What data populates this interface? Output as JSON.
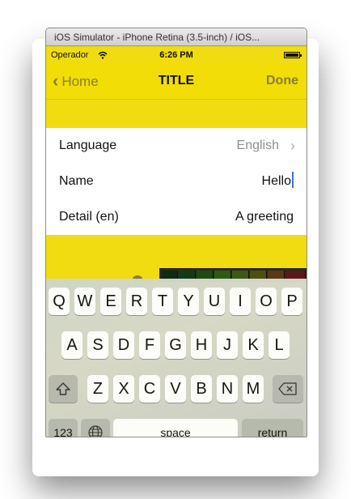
{
  "window": {
    "title": "iOS Simulator - iPhone Retina (3.5-inch) / iOS..."
  },
  "statusbar": {
    "carrier": "Operador",
    "time": "6:26 PM"
  },
  "navbar": {
    "back": "Home",
    "title": "TITLE",
    "done": "Done"
  },
  "table": {
    "rows": [
      {
        "label": "Language",
        "value": "English"
      },
      {
        "label": "Name",
        "value": "Hello"
      },
      {
        "label": "Detail (en)",
        "value": "A greeting"
      }
    ]
  },
  "keyboard": {
    "row1": [
      "Q",
      "W",
      "E",
      "R",
      "T",
      "Y",
      "U",
      "I",
      "O",
      "P"
    ],
    "row2": [
      "A",
      "S",
      "D",
      "F",
      "G",
      "H",
      "J",
      "K",
      "L"
    ],
    "row3": [
      "Z",
      "X",
      "C",
      "V",
      "B",
      "N",
      "M"
    ],
    "numbers": "123",
    "space": "space",
    "return": "return"
  },
  "colors": {
    "accent": "#f2dd06",
    "nav_text": "#8a7e2b",
    "caret": "#3b74d8"
  },
  "icons": [
    "wifi-icon",
    "battery-icon",
    "chevron-left-icon",
    "chevron-right-icon",
    "shift-icon",
    "delete-icon",
    "globe-icon"
  ]
}
